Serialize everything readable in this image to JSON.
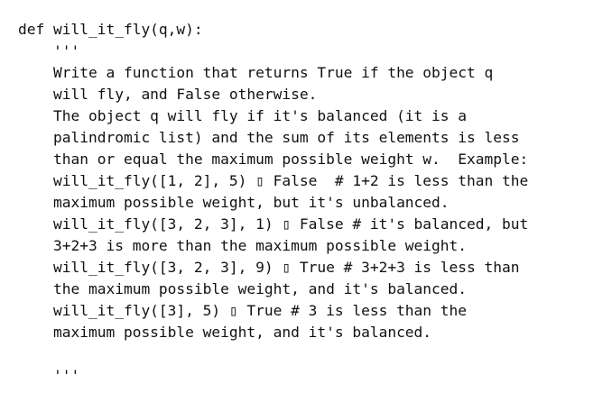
{
  "document": {
    "lines": [
      "def will_it_fly(q,w):",
      "    '''",
      "    Write a function that returns True if the object q",
      "    will fly, and False otherwise.",
      "    The object q will fly if it's balanced (it is a",
      "    palindromic list) and the sum of its elements is less",
      "    than or equal the maximum possible weight w.  Example:",
      "    will_it_fly([1, 2], 5) ▯ False  # 1+2 is less than the",
      "    maximum possible weight, but it's unbalanced.",
      "    will_it_fly([3, 2, 3], 1) ▯ False # it's balanced, but",
      "    3+2+3 is more than the maximum possible weight.",
      "    will_it_fly([3, 2, 3], 9) ▯ True # 3+2+3 is less than",
      "    the maximum possible weight, and it's balanced.",
      "    will_it_fly([3], 5) ▯ True # 3 is less than the",
      "    maximum possible weight, and it's balanced.",
      "",
      "    '''"
    ]
  }
}
